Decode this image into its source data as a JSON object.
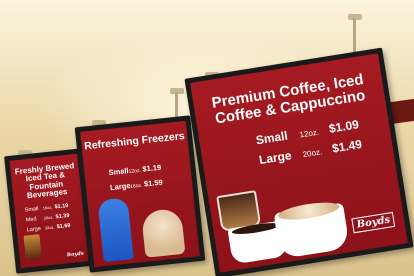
{
  "panels": {
    "left": {
      "title": "Freshly Brewed Iced Tea & Fountain Beverages",
      "rows": [
        {
          "size": "Small",
          "oz": "16oz.",
          "price": "$1.19"
        },
        {
          "size": "Med",
          "oz": "20oz.",
          "price": "$1.39"
        },
        {
          "size": "Large",
          "oz": "32oz.",
          "price": "$1.69"
        }
      ],
      "logo": "Boyds"
    },
    "middle": {
      "title": "Refreshing Freezers",
      "rows": [
        {
          "size": "Small",
          "oz": "12oz.",
          "price": "$1.19"
        },
        {
          "size": "Large",
          "oz": "16oz.",
          "price": "$1.59"
        }
      ]
    },
    "right": {
      "title": "Premium Coffee, Iced Coffee & Cappuccino",
      "rows": [
        {
          "size": "Small",
          "oz": "12oz.",
          "price": "$1.09"
        },
        {
          "size": "Large",
          "oz": "20oz.",
          "price": "$1.49"
        }
      ],
      "logo": "Boyds"
    }
  },
  "colors": {
    "board_red": "#9b1820",
    "frame": "#1a1a1a",
    "ceiling": "#f2e3bd"
  }
}
